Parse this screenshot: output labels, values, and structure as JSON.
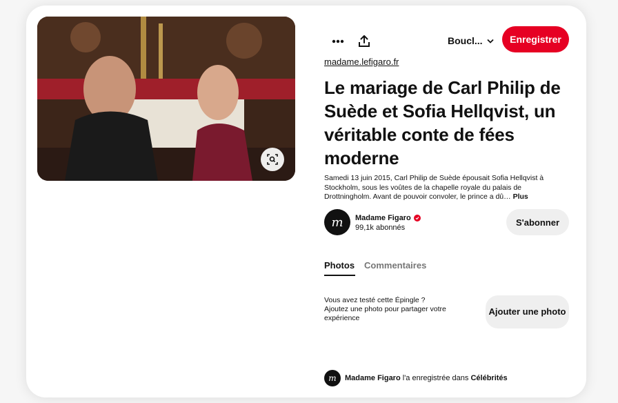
{
  "toolbar": {
    "more_icon": "more-dots-icon",
    "share_icon": "share-upload-icon",
    "board_select_label": "Boucl...",
    "board_select_icon": "chevron-down-icon",
    "save_label": "Enregistrer"
  },
  "image": {
    "alt": "",
    "lens_icon": "visual-search-icon"
  },
  "pin": {
    "source": "madame.lefigaro.fr",
    "title": "Le mariage de Carl Philip de Suède et Sofia Hellqvist, un véritable conte de fées moderne",
    "description": "Samedi 13 juin 2015, Carl Philip de Suède épousait Sofia Hellqvist à Stockholm, sous les voûtes de la chapelle royale du palais de Drottningholm. Avant de pouvoir convoler, le prince a dû…",
    "more_label": "Plus"
  },
  "author": {
    "avatar_letter": "m",
    "name": "Madame Figaro",
    "verified_icon": "verified-badge-icon",
    "followers": "99,1k abonnés",
    "follow_label": "S'abonner"
  },
  "tabs": [
    {
      "label": "Photos",
      "active": true
    },
    {
      "label": "Commentaires",
      "active": false
    }
  ],
  "tried": {
    "text_line1": "Vous avez testé cette Épingle ?",
    "text_line2": "Ajoutez une photo pour partager votre expérience",
    "button_label": "Ajouter une photo"
  },
  "saved_by": {
    "avatar_letter": "m",
    "name": "Madame Figaro",
    "middle_text": " l'a enregistrée dans ",
    "board": "Célébrités"
  },
  "colors": {
    "accent": "#e60023",
    "secondary_button": "#efefef"
  }
}
